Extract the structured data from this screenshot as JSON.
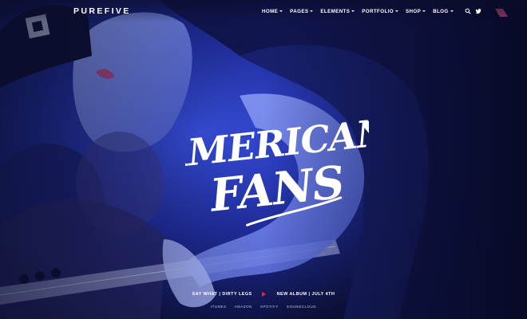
{
  "brand": {
    "logo_text": "PUREFIVE"
  },
  "nav": {
    "items": [
      {
        "label": "HOME",
        "has_dropdown": true
      },
      {
        "label": "PAGES",
        "has_dropdown": true
      },
      {
        "label": "ELEMENTS",
        "has_dropdown": true
      },
      {
        "label": "PORTFOLIO",
        "has_dropdown": true
      },
      {
        "label": "SHOP",
        "has_dropdown": true
      },
      {
        "label": "BLOG",
        "has_dropdown": true
      }
    ],
    "icons": [
      "search-icon",
      "twitter-icon"
    ]
  },
  "hero": {
    "title_line1": "AMERICAN",
    "title_line2": "FANS",
    "album_left": "SAY WHAT | DIRTY LEGS",
    "album_right": "NEW ALBUM | JULY 4TH",
    "stores": [
      "ITUNES",
      "AMAZON",
      "SPOTIFY",
      "SOUNDCLOUD"
    ]
  },
  "colors": {
    "background": "#07091c",
    "hero_tint": "#2a3cc8",
    "accent": "#e0284a",
    "text": "#ffffff"
  }
}
